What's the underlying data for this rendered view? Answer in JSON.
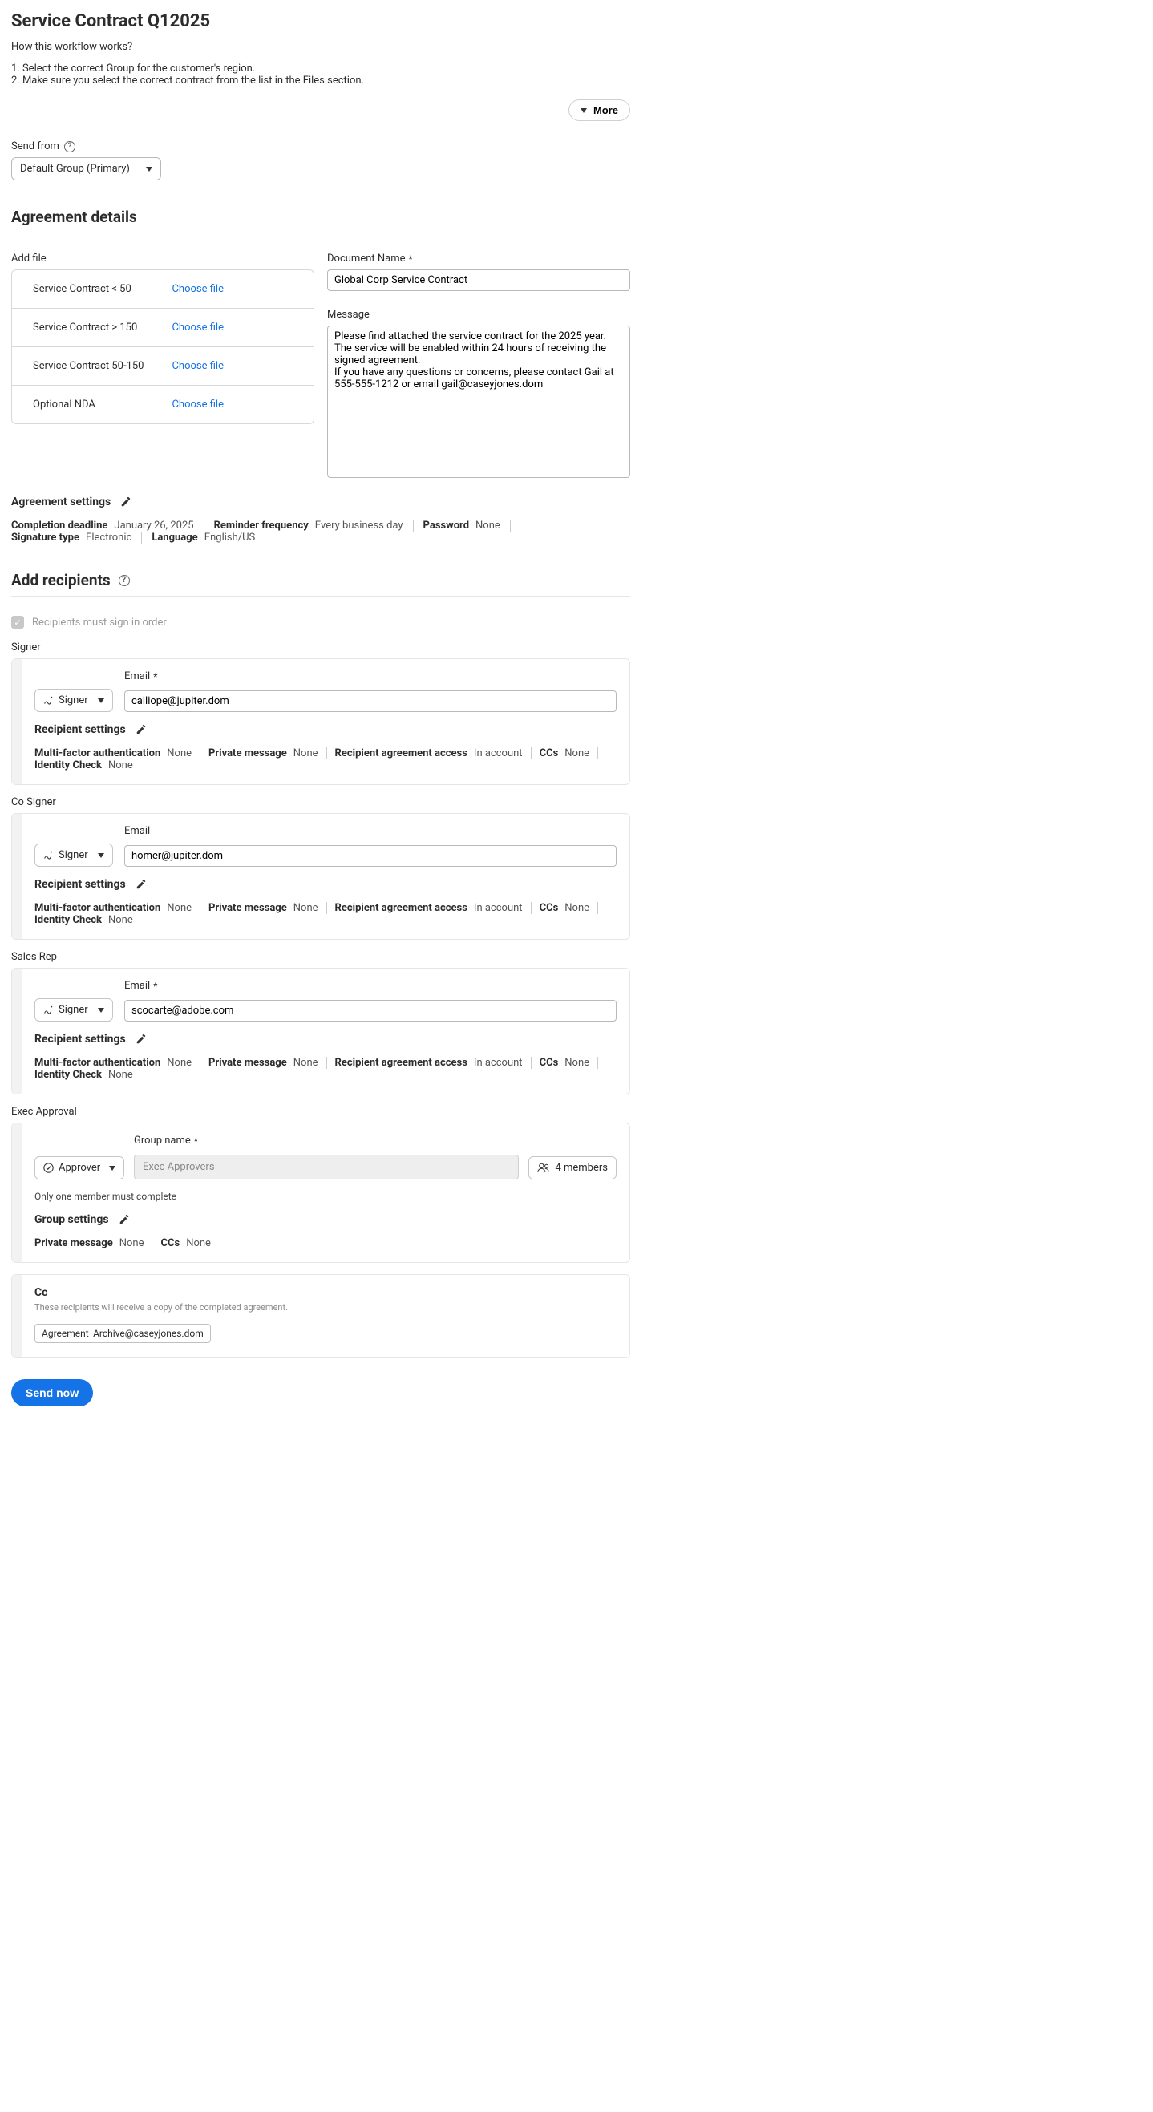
{
  "header": {
    "title": "Service Contract Q12025",
    "intro": "How this workflow works?",
    "step1": "1. Select the correct Group for the customer's region.",
    "step2": "2. Make sure you select the correct contract from the list in the Files section.",
    "more": "More"
  },
  "sendFrom": {
    "label": "Send from",
    "value": "Default Group (Primary)"
  },
  "agreement": {
    "heading": "Agreement details",
    "addFileLabel": "Add file",
    "files": [
      {
        "name": "Service Contract  <  50",
        "action": "Choose file"
      },
      {
        "name": "Service Contract  >  150",
        "action": "Choose file"
      },
      {
        "name": "Service Contract 50-150",
        "action": "Choose file"
      },
      {
        "name": "Optional NDA",
        "action": "Choose file"
      }
    ],
    "docNameLabel": "Document Name",
    "docName": "Global Corp Service Contract",
    "messageLabel": "Message",
    "message": "Please find attached the service contract for the 2025 year.\nThe service will be enabled within 24 hours of receiving the signed agreement.\nIf you have any questions or concerns, please contact Gail at 555-555-1212 or email gail@caseyjones.dom"
  },
  "agreementSettings": {
    "heading": "Agreement settings",
    "items": [
      {
        "key": "Completion deadline",
        "val": "January 26, 2025"
      },
      {
        "key": "Reminder frequency",
        "val": "Every business day"
      },
      {
        "key": "Password",
        "val": "None"
      },
      {
        "key": "Signature type",
        "val": "Electronic"
      },
      {
        "key": "Language",
        "val": "English/US"
      }
    ]
  },
  "recipients": {
    "heading": "Add recipients",
    "orderLabel": "Recipients must sign in order",
    "settingsHead": "Recipient settings",
    "groupSettingsHead": "Group settings",
    "emailLabel": "Email",
    "groupNameLabel": "Group name",
    "membersLabel": "4 members",
    "onlyOne": "Only one member must complete",
    "roleSigner": "Signer",
    "roleApprover": "Approver",
    "groupPlaceholder": "Exec Approvers",
    "defaultSettings": [
      {
        "key": "Multi-factor authentication",
        "val": "None"
      },
      {
        "key": "Private message",
        "val": "None"
      },
      {
        "key": "Recipient agreement access",
        "val": "In account"
      },
      {
        "key": "CCs",
        "val": "None"
      },
      {
        "key": "Identity Check",
        "val": "None"
      }
    ],
    "groupSettings": [
      {
        "key": "Private message",
        "val": "None"
      },
      {
        "key": "CCs",
        "val": "None"
      }
    ],
    "list": [
      {
        "label": "Signer",
        "required": true,
        "email": "calliope@jupiter.dom"
      },
      {
        "label": "Co Signer",
        "required": false,
        "email": "homer@jupiter.dom"
      },
      {
        "label": "Sales Rep",
        "required": true,
        "email": "scocarte@adobe.com"
      }
    ],
    "execLabel": "Exec Approval"
  },
  "cc": {
    "title": "Cc",
    "desc": "These recipients will receive a copy of the completed agreement.",
    "chip": "Agreement_Archive@caseyjones.dom"
  },
  "send": "Send now"
}
